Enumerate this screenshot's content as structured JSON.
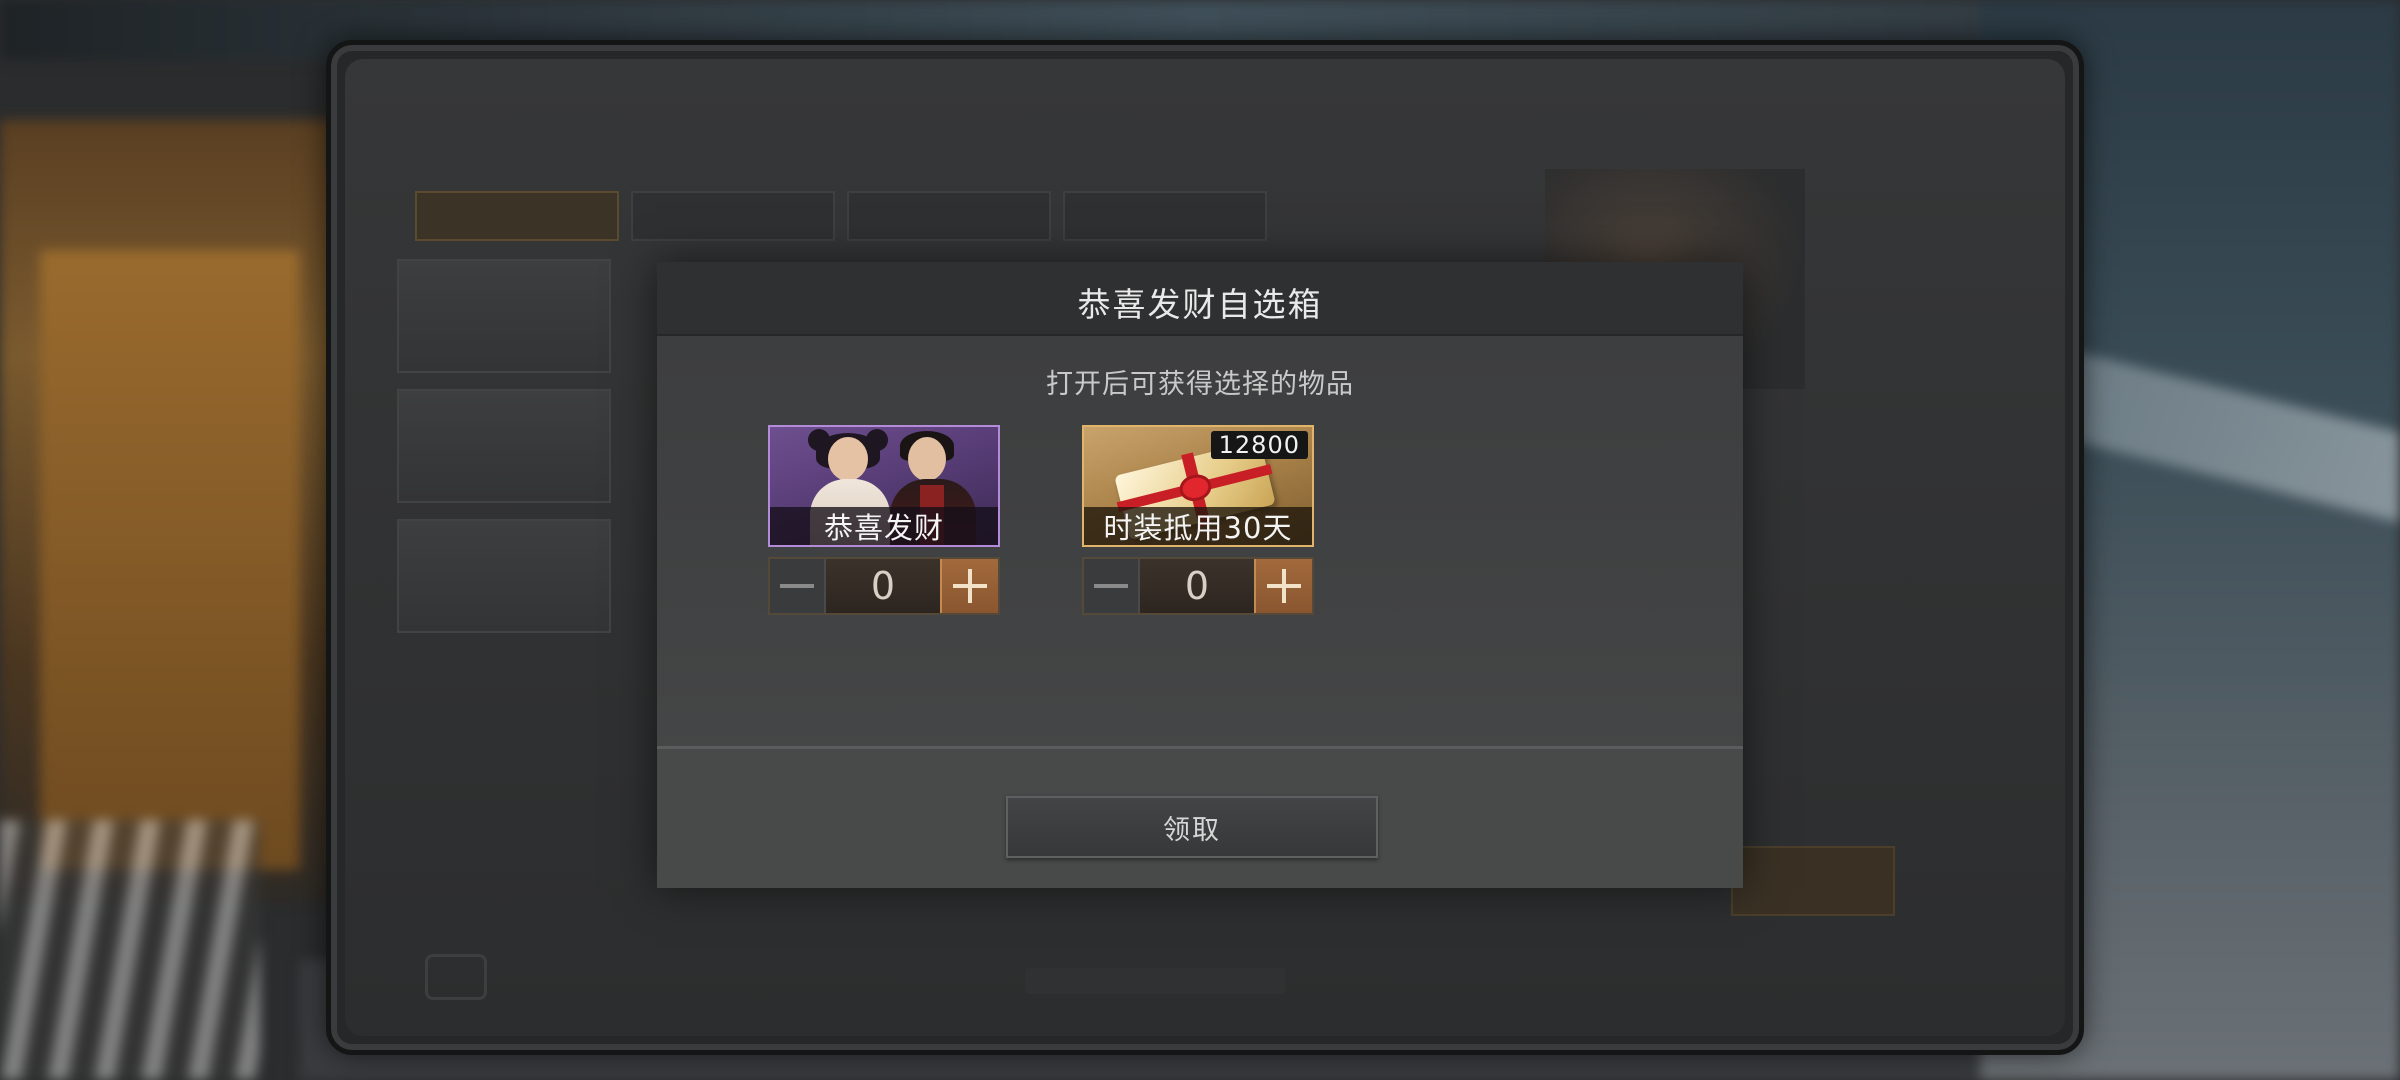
{
  "modal": {
    "title": "恭喜发财自选箱",
    "subtitle": "打开后可获得选择的物品",
    "claim_label": "领取"
  },
  "items": [
    {
      "name": "恭喜发财",
      "quantity": "0",
      "rarity_color": "#b48bd8",
      "icon": "characters-outfit-icon"
    },
    {
      "name": "时装抵用30天",
      "badge": "12800",
      "quantity": "0",
      "rarity_color": "#e0b46a",
      "icon": "gift-voucher-icon"
    }
  ],
  "colors": {
    "accent": "#a26a3c",
    "modal_bg": "#404142"
  }
}
